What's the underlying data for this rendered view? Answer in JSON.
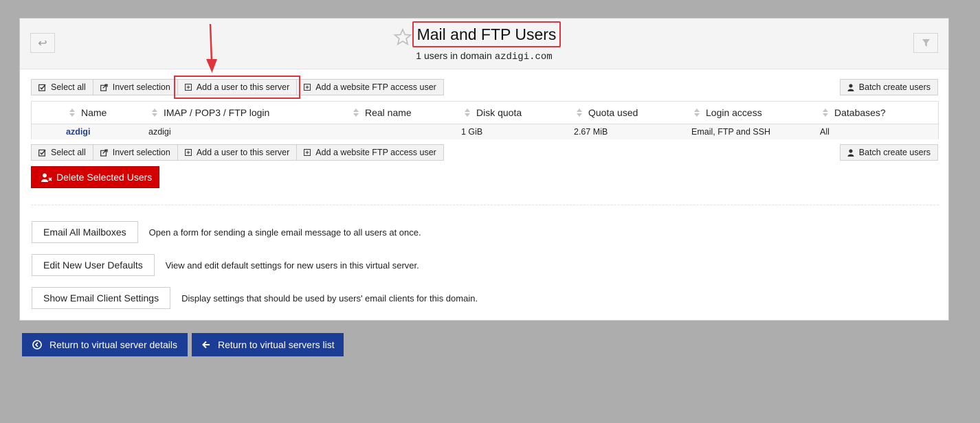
{
  "header": {
    "title": "Mail and FTP Users",
    "subtitle_prefix": "1 users in domain ",
    "subtitle_domain": "azdigi.com"
  },
  "toolbar": {
    "select_all": "Select all",
    "invert_selection": "Invert selection",
    "add_user": "Add a user to this server",
    "add_ftp_user": "Add a website FTP access user",
    "batch_create": "Batch create users"
  },
  "table": {
    "columns": [
      "Name",
      "IMAP / POP3 / FTP login",
      "Real name",
      "Disk quota",
      "Quota used",
      "Login access",
      "Databases?"
    ],
    "rows": [
      {
        "name": "azdigi",
        "login": "azdigi",
        "real_name": "",
        "disk_quota": "1 GiB",
        "quota_used": "2.67 MiB",
        "login_access": "Email, FTP and SSH",
        "databases": "All"
      }
    ]
  },
  "delete_button": "Delete Selected Users",
  "actions": [
    {
      "label": "Email All Mailboxes",
      "description": "Open a form for sending a single email message to all users at once."
    },
    {
      "label": "Edit New User Defaults",
      "description": "View and edit default settings for new users in this virtual server."
    },
    {
      "label": "Show Email Client Settings",
      "description": "Display settings that should be used by users' email clients for this domain."
    }
  ],
  "nav": {
    "return_details": "Return to virtual server details",
    "return_list": "Return to virtual servers list"
  },
  "colors": {
    "primary": "#1b3d96",
    "danger": "#d40000",
    "highlight": "#e0333c",
    "link": "#1f3f9a"
  }
}
